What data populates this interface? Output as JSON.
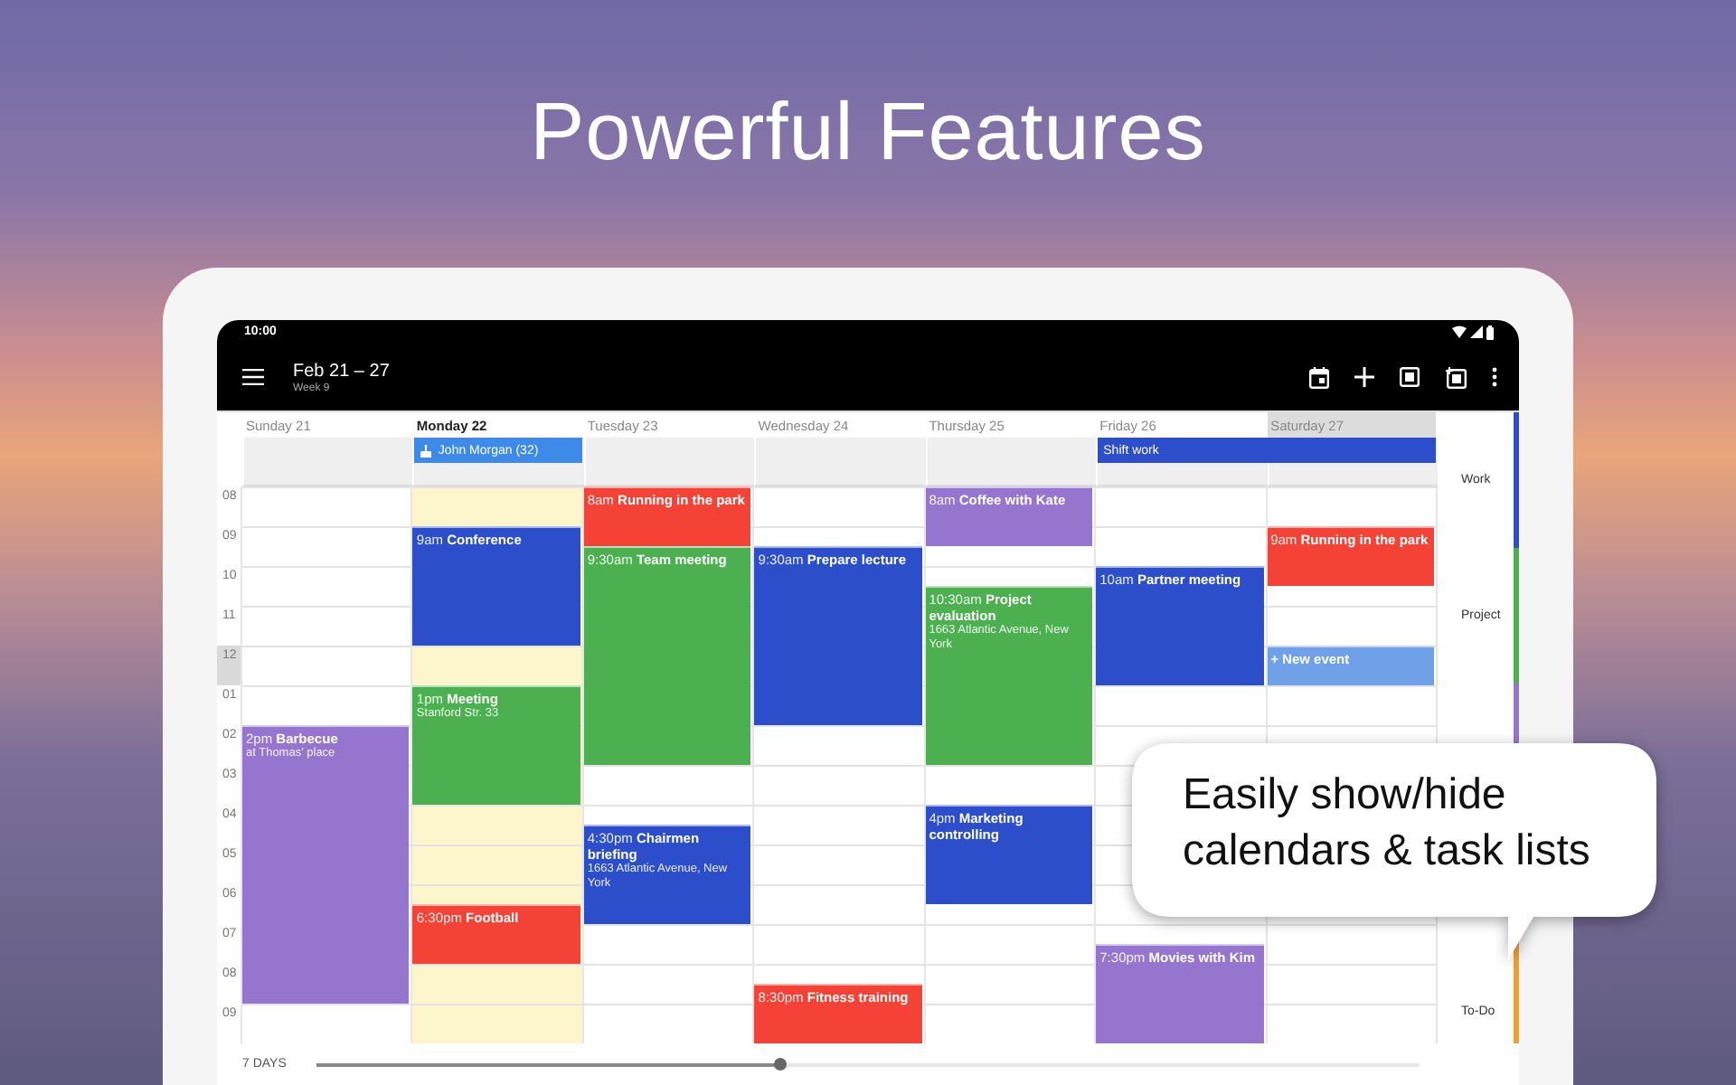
{
  "headline": "Powerful Features",
  "status_bar": {
    "time": "10:00"
  },
  "toolbar": {
    "title": "Feb 21 – 27",
    "subtitle": "Week 9"
  },
  "hours": [
    {
      "label": "08",
      "current": false
    },
    {
      "label": "09",
      "current": false
    },
    {
      "label": "10",
      "current": false
    },
    {
      "label": "11",
      "current": false
    },
    {
      "label": "12",
      "current": true
    },
    {
      "label": "01",
      "current": false
    },
    {
      "label": "02",
      "current": false
    },
    {
      "label": "03",
      "current": false
    },
    {
      "label": "04",
      "current": false
    },
    {
      "label": "05",
      "current": false
    },
    {
      "label": "06",
      "current": false
    },
    {
      "label": "07",
      "current": false
    },
    {
      "label": "08",
      "current": false
    },
    {
      "label": "09",
      "current": false
    }
  ],
  "days": [
    {
      "label": "Sunday 21",
      "today": false,
      "selected": false,
      "slots": [
        {
          "kind": "free"
        },
        {
          "kind": "free"
        },
        {
          "kind": "free"
        },
        {
          "kind": "free"
        },
        {
          "kind": "free"
        },
        {
          "kind": "free"
        },
        {
          "kind": "free"
        },
        {
          "kind": "free"
        },
        {
          "kind": "free"
        },
        {
          "kind": "free"
        },
        {
          "kind": "free"
        },
        {
          "kind": "free"
        },
        {
          "kind": "event",
          "time": "2pm",
          "title": "Barbecue",
          "detail": "at Thomas' place",
          "color": "#9575cd"
        },
        {
          "kind": "continued"
        },
        {
          "kind": "continued"
        },
        {
          "kind": "continued"
        },
        {
          "kind": "continued"
        },
        {
          "kind": "continued"
        },
        {
          "kind": "continued"
        },
        {
          "kind": "continued"
        },
        {
          "kind": "continued"
        },
        {
          "kind": "continued"
        },
        {
          "kind": "continued"
        },
        {
          "kind": "continued"
        },
        {
          "kind": "continued"
        },
        {
          "kind": "continued"
        },
        {
          "kind": "free"
        },
        {
          "kind": "free"
        }
      ]
    },
    {
      "label": "Monday 22",
      "today": true,
      "selected": false,
      "all_day": [
        {
          "kind": "birthday",
          "title": "John Morgan (32)",
          "continues": false,
          "color": "#3d8ae8"
        }
      ],
      "slots": [
        {
          "kind": "free"
        },
        {
          "kind": "free"
        },
        {
          "kind": "event",
          "time": "9am",
          "title": "Conference",
          "color": "#2c4ecb"
        },
        {
          "kind": "continued"
        },
        {
          "kind": "continued"
        },
        {
          "kind": "continued"
        },
        {
          "kind": "continued"
        },
        {
          "kind": "continued"
        },
        {
          "kind": "free"
        },
        {
          "kind": "free"
        },
        {
          "kind": "event",
          "time": "1pm",
          "title": "Meeting",
          "detail": "Stanford Str. 33",
          "color": "#4caf50"
        },
        {
          "kind": "continued"
        },
        {
          "kind": "continued"
        },
        {
          "kind": "continued"
        },
        {
          "kind": "continued"
        },
        {
          "kind": "continued"
        },
        {
          "kind": "free"
        },
        {
          "kind": "free"
        },
        {
          "kind": "free"
        },
        {
          "kind": "free"
        },
        {
          "kind": "free"
        },
        {
          "kind": "event",
          "time": "6:30pm",
          "title": "Football",
          "color": "#f44336"
        },
        {
          "kind": "continued"
        },
        {
          "kind": "continued"
        },
        {
          "kind": "free"
        },
        {
          "kind": "free"
        },
        {
          "kind": "free"
        },
        {
          "kind": "free"
        }
      ]
    },
    {
      "label": "Tuesday 23",
      "today": false,
      "selected": false,
      "slots": [
        {
          "kind": "event",
          "time": "8am",
          "title": "Running in the park",
          "color": "#f44336"
        },
        {
          "kind": "continued"
        },
        {
          "kind": "continued"
        },
        {
          "kind": "event",
          "time": "9:30am",
          "title": "Team meeting",
          "color": "#4caf50"
        },
        {
          "kind": "continued"
        },
        {
          "kind": "continued"
        },
        {
          "kind": "continued"
        },
        {
          "kind": "continued"
        },
        {
          "kind": "continued"
        },
        {
          "kind": "continued"
        },
        {
          "kind": "continued"
        },
        {
          "kind": "continued"
        },
        {
          "kind": "continued"
        },
        {
          "kind": "continued"
        },
        {
          "kind": "free"
        },
        {
          "kind": "free"
        },
        {
          "kind": "free"
        },
        {
          "kind": "event",
          "time": "4:30pm",
          "title": "Chairmen briefing",
          "detail": "1663 Atlantic Avenue, New York",
          "color": "#2c4ecb"
        },
        {
          "kind": "continued"
        },
        {
          "kind": "continued"
        },
        {
          "kind": "continued"
        },
        {
          "kind": "continued"
        },
        {
          "kind": "free"
        },
        {
          "kind": "free"
        },
        {
          "kind": "free"
        },
        {
          "kind": "free"
        },
        {
          "kind": "free"
        },
        {
          "kind": "free"
        }
      ]
    },
    {
      "label": "Wednesday 24",
      "today": false,
      "selected": false,
      "slots": [
        {
          "kind": "free"
        },
        {
          "kind": "free"
        },
        {
          "kind": "free"
        },
        {
          "kind": "event",
          "time": "9:30am",
          "title": "Prepare lecture",
          "color": "#2c4ecb"
        },
        {
          "kind": "continued"
        },
        {
          "kind": "continued"
        },
        {
          "kind": "continued"
        },
        {
          "kind": "continued"
        },
        {
          "kind": "continued"
        },
        {
          "kind": "continued"
        },
        {
          "kind": "continued"
        },
        {
          "kind": "continued"
        },
        {
          "kind": "free"
        },
        {
          "kind": "free"
        },
        {
          "kind": "free"
        },
        {
          "kind": "free"
        },
        {
          "kind": "free"
        },
        {
          "kind": "free"
        },
        {
          "kind": "free"
        },
        {
          "kind": "free"
        },
        {
          "kind": "free"
        },
        {
          "kind": "free"
        },
        {
          "kind": "free"
        },
        {
          "kind": "free"
        },
        {
          "kind": "free"
        },
        {
          "kind": "event",
          "time": "8:30pm",
          "title": "Fitness training",
          "color": "#f44336"
        },
        {
          "kind": "continued"
        },
        {
          "kind": "continued"
        }
      ]
    },
    {
      "label": "Thursday 25",
      "today": false,
      "selected": false,
      "slots": [
        {
          "kind": "event",
          "time": "8am",
          "title": "Coffee with Kate",
          "color": "#9575cd"
        },
        {
          "kind": "continued"
        },
        {
          "kind": "continued"
        },
        {
          "kind": "free"
        },
        {
          "kind": "free"
        },
        {
          "kind": "event",
          "time": "10:30am",
          "title": "Project evaluation",
          "detail": "1663 Atlantic Avenue, New York",
          "color": "#4caf50"
        },
        {
          "kind": "continued"
        },
        {
          "kind": "continued"
        },
        {
          "kind": "continued"
        },
        {
          "kind": "continued"
        },
        {
          "kind": "continued"
        },
        {
          "kind": "continued"
        },
        {
          "kind": "continued"
        },
        {
          "kind": "continued"
        },
        {
          "kind": "free"
        },
        {
          "kind": "free"
        },
        {
          "kind": "event",
          "time": "4pm",
          "title": "Marketing controlling",
          "color": "#2c4ecb"
        },
        {
          "kind": "continued"
        },
        {
          "kind": "continued"
        },
        {
          "kind": "continued"
        },
        {
          "kind": "continued"
        },
        {
          "kind": "free"
        },
        {
          "kind": "free"
        },
        {
          "kind": "free"
        },
        {
          "kind": "free"
        },
        {
          "kind": "free"
        },
        {
          "kind": "free"
        },
        {
          "kind": "free"
        }
      ]
    },
    {
      "label": "Friday 26",
      "today": false,
      "selected": false,
      "all_day": [
        {
          "kind": "event",
          "title": "Shift work",
          "continues": true,
          "color": "#2c4ecb"
        }
      ],
      "slots": [
        {
          "kind": "free"
        },
        {
          "kind": "free"
        },
        {
          "kind": "free"
        },
        {
          "kind": "free"
        },
        {
          "kind": "event",
          "time": "10am",
          "title": "Partner meeting",
          "color": "#2c4ecb"
        },
        {
          "kind": "continued"
        },
        {
          "kind": "continued"
        },
        {
          "kind": "continued"
        },
        {
          "kind": "continued"
        },
        {
          "kind": "continued"
        },
        {
          "kind": "free"
        },
        {
          "kind": "free"
        },
        {
          "kind": "free"
        },
        {
          "kind": "free"
        },
        {
          "kind": "free"
        },
        {
          "kind": "free"
        },
        {
          "kind": "free"
        },
        {
          "kind": "free"
        },
        {
          "kind": "free"
        },
        {
          "kind": "free"
        },
        {
          "kind": "free"
        },
        {
          "kind": "free"
        },
        {
          "kind": "free"
        },
        {
          "kind": "event",
          "time": "7:30pm",
          "title": "Movies with Kim",
          "color": "#9575cd"
        },
        {
          "kind": "continued"
        },
        {
          "kind": "continued"
        },
        {
          "kind": "continued"
        },
        {
          "kind": "continued"
        }
      ]
    },
    {
      "label": "Saturday 27",
      "today": false,
      "selected": true,
      "slots": [
        {
          "kind": "free"
        },
        {
          "kind": "free"
        },
        {
          "kind": "event",
          "time": "9am",
          "title": "Running in the park",
          "color": "#f44336"
        },
        {
          "kind": "continued"
        },
        {
          "kind": "continued"
        },
        {
          "kind": "free"
        },
        {
          "kind": "free"
        },
        {
          "kind": "free"
        },
        {
          "kind": "event",
          "title": "+ New event",
          "color": "#6fa0e8"
        },
        {
          "kind": "continued"
        },
        {
          "kind": "free"
        },
        {
          "kind": "free"
        },
        {
          "kind": "free"
        },
        {
          "kind": "free"
        },
        {
          "kind": "free"
        },
        {
          "kind": "free"
        },
        {
          "kind": "free"
        },
        {
          "kind": "free"
        },
        {
          "kind": "free"
        },
        {
          "kind": "free"
        },
        {
          "kind": "free"
        },
        {
          "kind": "free"
        },
        {
          "kind": "free"
        },
        {
          "kind": "free"
        },
        {
          "kind": "free"
        },
        {
          "kind": "free"
        },
        {
          "kind": "free"
        },
        {
          "kind": "free"
        }
      ]
    }
  ],
  "calendars": [
    {
      "name": "Work",
      "color": "#2c4ecb"
    },
    {
      "name": "Project",
      "color": "#4caf50"
    },
    {
      "color": "#9575cd"
    },
    {
      "name": "To-Do",
      "color": "#f0a030"
    }
  ],
  "range_slider": {
    "label": "7 DAYS",
    "level": 0.42
  },
  "callout": {
    "text": "Easily show/hide calendars & task lists"
  }
}
